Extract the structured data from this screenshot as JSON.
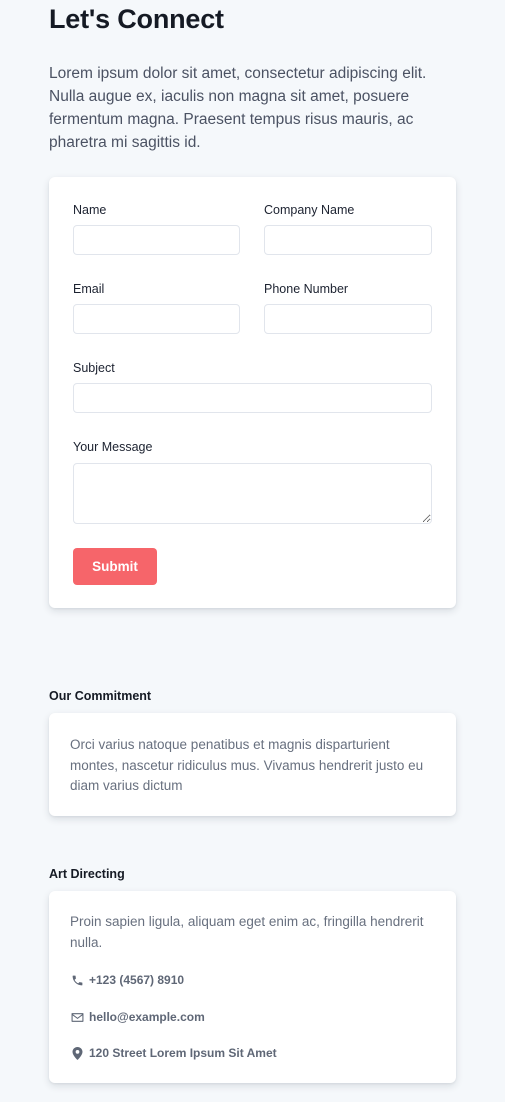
{
  "header": {
    "title": "Let's Connect",
    "intro": "Lorem ipsum dolor sit amet, consectetur adipiscing elit. Nulla augue ex, iaculis non magna sit amet, posuere fermentum magna. Praesent tempus risus mauris, ac pharetra mi sagittis id."
  },
  "form": {
    "name_label": "Name",
    "name_value": "",
    "company_label": "Company Name",
    "company_value": "",
    "email_label": "Email",
    "email_value": "",
    "phone_label": "Phone Number",
    "phone_value": "",
    "subject_label": "Subject",
    "subject_value": "",
    "message_label": "Your Message",
    "message_value": "",
    "submit_label": "Submit"
  },
  "commitment": {
    "title": "Our Commitment",
    "text": "Orci varius natoque penatibus et magnis disparturient montes, nascetur ridiculus mus. Vivamus hendrerit justo eu diam varius dictum"
  },
  "art_directing": {
    "title": "Art Directing",
    "text": "Proin sapien ligula, aliquam eget enim ac, fringilla hendrerit nulla.",
    "phone": "+123 (4567) 8910",
    "email": "hello@example.com",
    "address": "120 Street Lorem Ipsum Sit Amet",
    "phone_icon": "phone-icon",
    "email_icon": "envelope-icon",
    "address_icon": "map-pin-icon"
  },
  "colors": {
    "accent": "#f6656a",
    "background": "#f5f8fb",
    "card": "#ffffff",
    "icon": "#5f6776"
  }
}
